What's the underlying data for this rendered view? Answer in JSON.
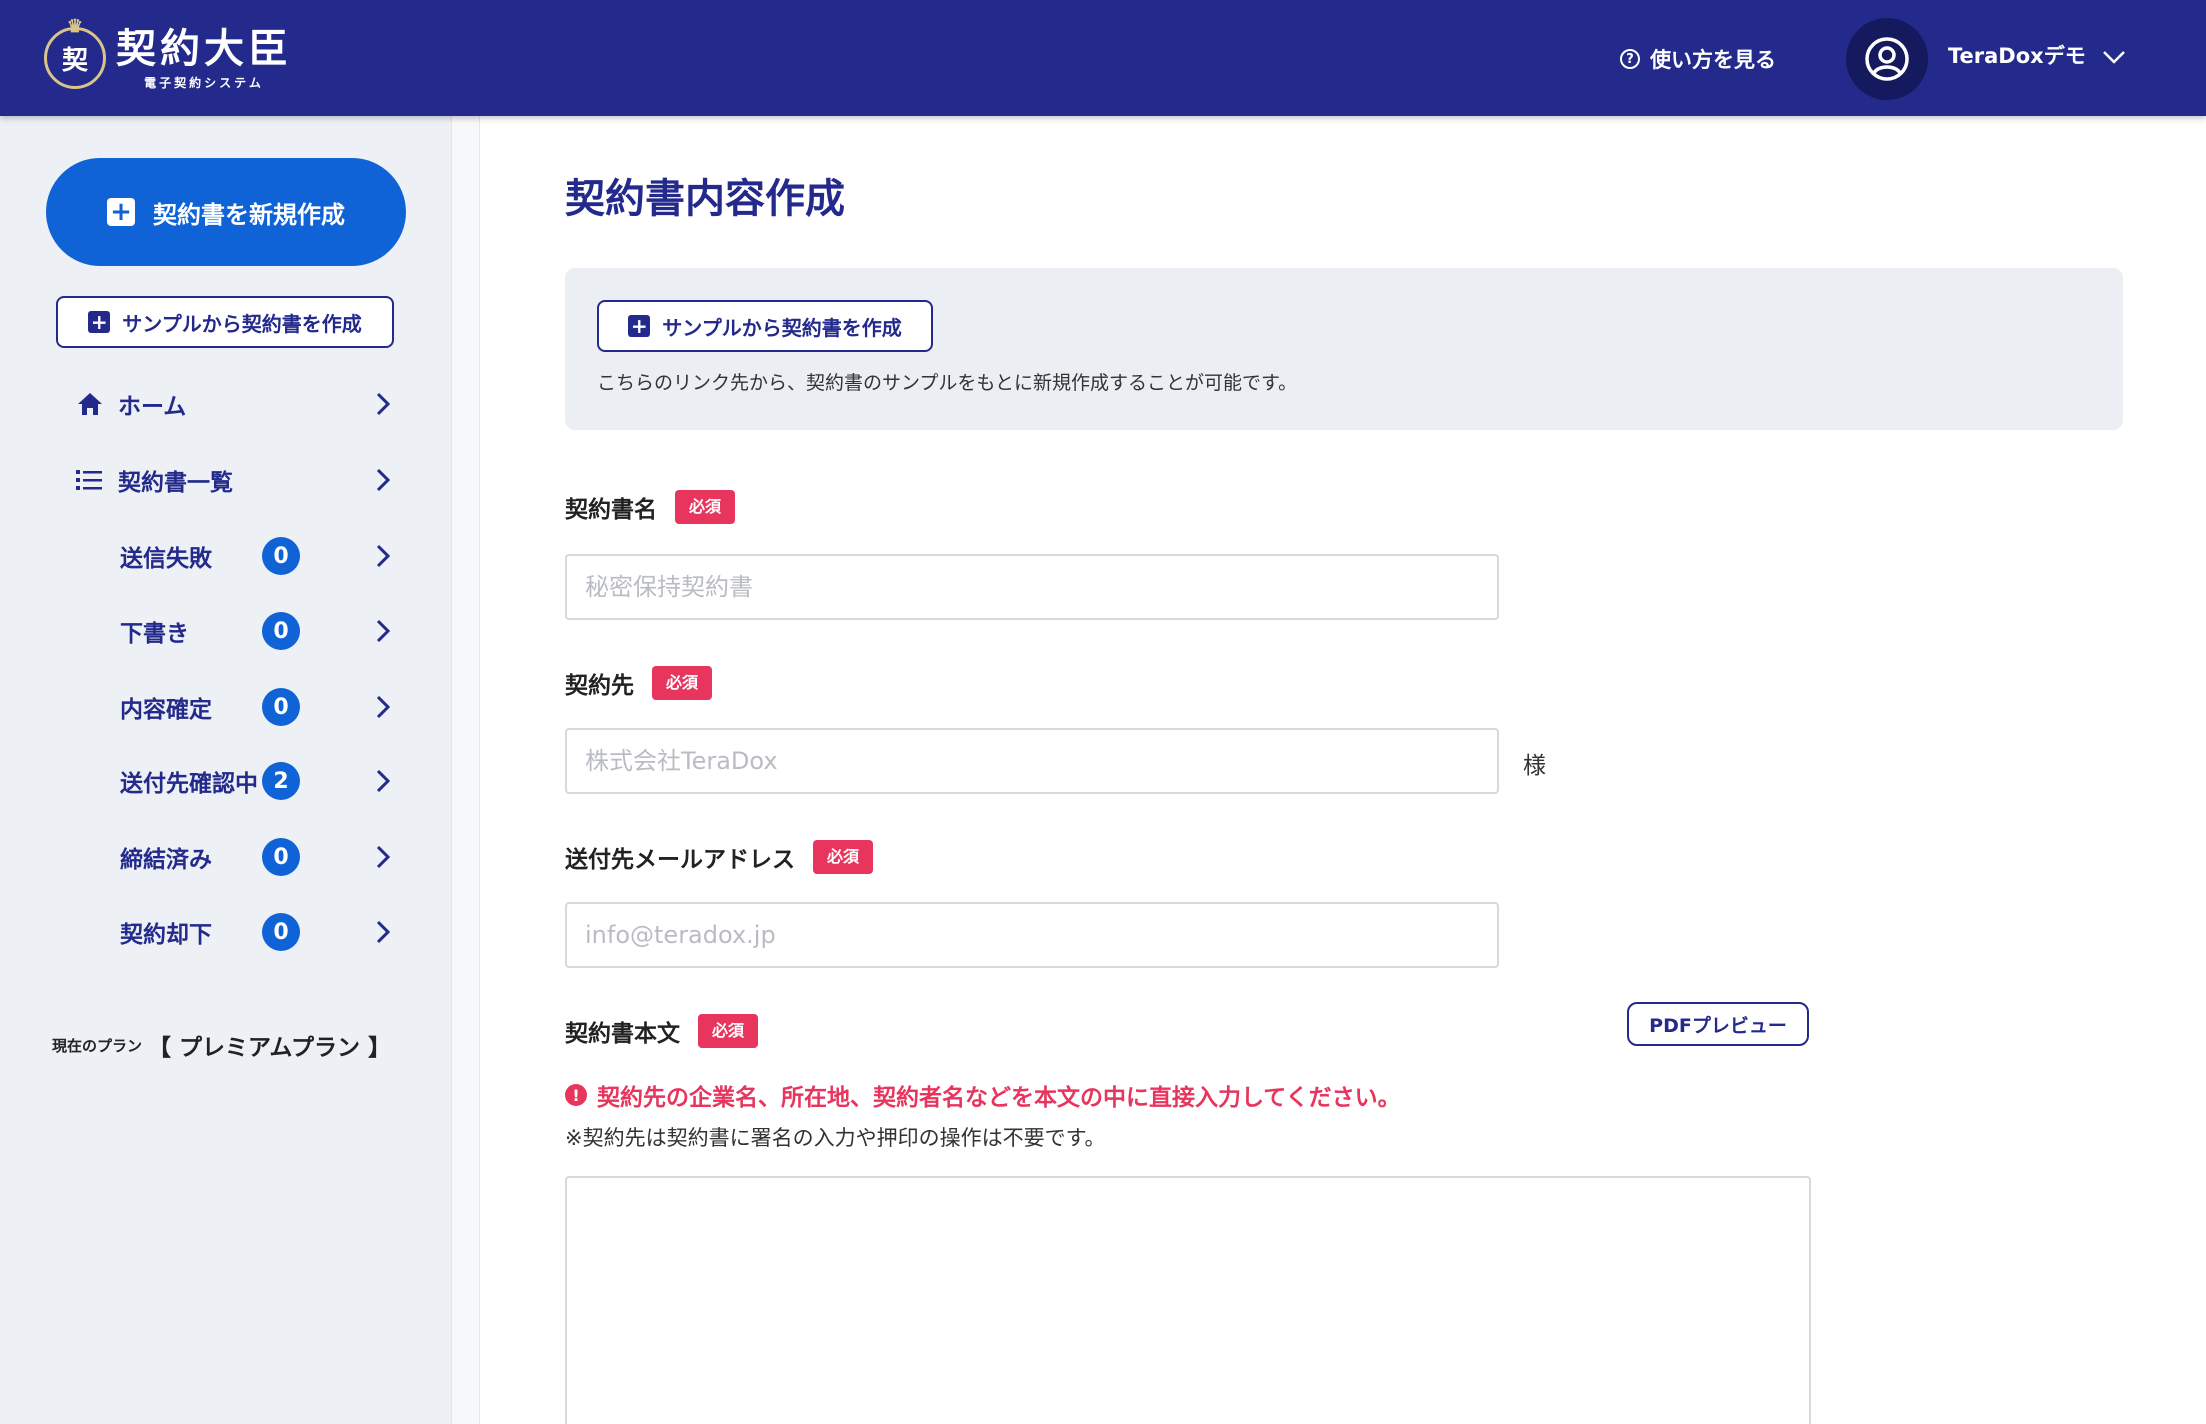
{
  "header": {
    "logo_title": "契約大臣",
    "logo_subtitle": "電子契約システム",
    "logo_emblem_char": "契",
    "help_label": "使い方を見る",
    "user_name": "TeraDoxデモ"
  },
  "sidebar": {
    "new_button_label": "契約書を新規作成",
    "sample_button_label": "サンプルから契約書を作成",
    "nav_items": [
      {
        "label": "ホーム",
        "icon": "home-icon"
      },
      {
        "label": "契約書一覧",
        "icon": "list-icon"
      }
    ],
    "sub_items": [
      {
        "label": "送信失敗",
        "count": "0"
      },
      {
        "label": "下書き",
        "count": "0"
      },
      {
        "label": "内容確定",
        "count": "0"
      },
      {
        "label": "送付先確認中",
        "count": "2"
      },
      {
        "label": "締結済み",
        "count": "0"
      },
      {
        "label": "契約却下",
        "count": "0"
      }
    ],
    "plan_label": "現在のプラン",
    "plan_name": "【 プレミアムプラン 】"
  },
  "main": {
    "title": "契約書内容作成",
    "sample_button_label": "サンプルから契約書を作成",
    "info_text": "こちらのリンク先から、契約書のサンプルをもとに新規作成することが可能です。",
    "required_label": "必須",
    "fields": {
      "contract_name": {
        "label": "契約書名",
        "placeholder": "秘密保持契約書",
        "value": ""
      },
      "counterparty": {
        "label": "契約先",
        "placeholder": "株式会社TeraDox",
        "value": "",
        "suffix": "様"
      },
      "email": {
        "label": "送付先メールアドレス",
        "placeholder": "info@teradox.jp",
        "value": ""
      },
      "body": {
        "label": "契約書本文",
        "value": ""
      }
    },
    "pdf_preview_label": "PDFプレビュー",
    "warning_text": "契約先の企業名、所在地、契約者名などを本文の中に直接入力してください。",
    "note_text": "※契約先は契約書に署名の入力や押印の操作は不要です。"
  },
  "colors": {
    "header_bg": "#232a8b",
    "primary_blue": "#0f63d6",
    "required_red": "#e8355e",
    "sidebar_bg": "#edf0f5",
    "info_box_bg": "#ebeef3"
  }
}
